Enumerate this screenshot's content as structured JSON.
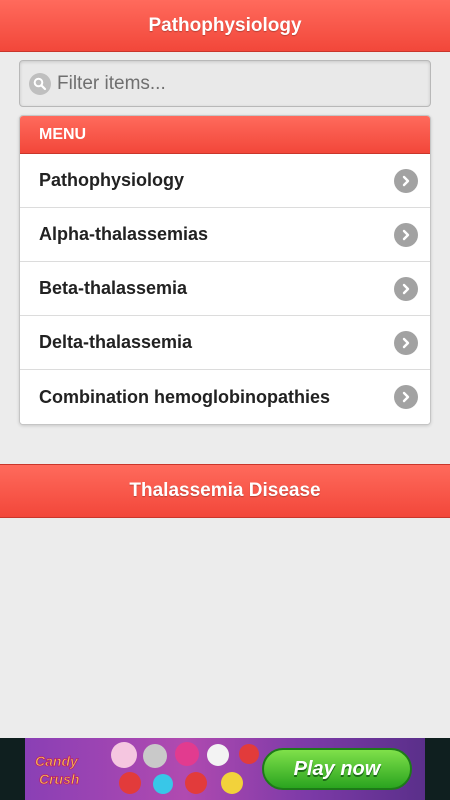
{
  "header": {
    "title": "Pathophysiology"
  },
  "search": {
    "placeholder": "Filter items...",
    "icon": "search-icon"
  },
  "menu": {
    "divider_label": "MENU",
    "items": [
      {
        "label": "Pathophysiology",
        "icon": "chevron-right-icon"
      },
      {
        "label": "Alpha-thalassemias",
        "icon": "chevron-right-icon"
      },
      {
        "label": "Beta-thalassemia",
        "icon": "chevron-right-icon"
      },
      {
        "label": "Delta-thalassemia",
        "icon": "chevron-right-icon"
      },
      {
        "label": "Combination hemoglobinopathies",
        "icon": "chevron-right-icon"
      }
    ]
  },
  "footer": {
    "title": "Thalassemia Disease"
  },
  "ad": {
    "brand": "Candy Crush",
    "cta_label": "Play now"
  },
  "colors": {
    "accent": "#f2473a",
    "background": "#ececec",
    "play_button": "#2aa41f"
  }
}
